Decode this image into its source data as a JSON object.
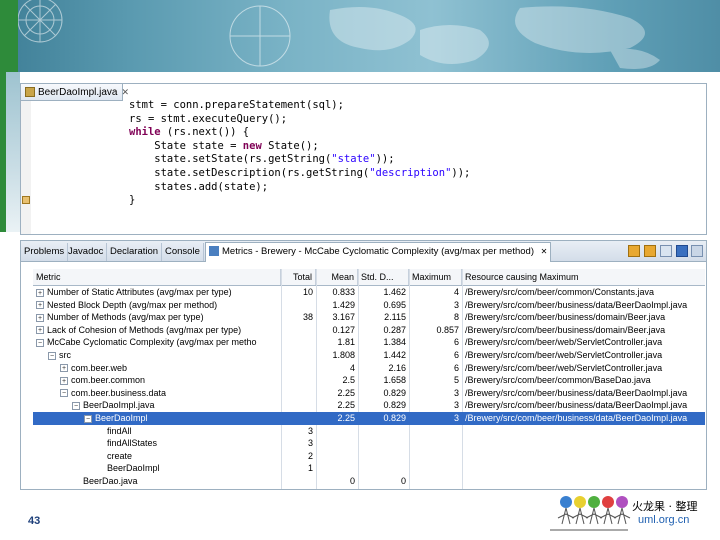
{
  "editor": {
    "tab_label": "BeerDaoImpl.java",
    "tab_close": "✕",
    "code_lines": [
      [
        {
          "t": "stmt = conn.prepareStatement(sql);"
        }
      ],
      [
        {
          "t": "rs = stmt.executeQuery();"
        }
      ],
      [
        {
          "t": "while",
          "k": "kw"
        },
        {
          "t": " (rs.next()) {"
        }
      ],
      [
        {
          "t": "    State state = "
        },
        {
          "t": "new",
          "k": "kw"
        },
        {
          "t": " State();"
        }
      ],
      [
        {
          "t": "    state.setState(rs.getString("
        },
        {
          "t": "\"state\"",
          "k": "str"
        },
        {
          "t": "));"
        }
      ],
      [
        {
          "t": "    state.setDescription(rs.getString("
        },
        {
          "t": "\"description\"",
          "k": "str"
        },
        {
          "t": "));"
        }
      ],
      [
        {
          "t": "    states.add(state);"
        }
      ],
      [
        {
          "t": "}"
        }
      ]
    ]
  },
  "views": {
    "tabs": [
      "Problems",
      "Javadoc",
      "Declaration",
      "Console"
    ],
    "active_tab": "Metrics - Brewery - McCabe Cyclomatic Complexity (avg/max per method)",
    "active_tab_close": "✕"
  },
  "table": {
    "columns": [
      "Metric",
      "Total",
      "Mean",
      "Std. D...",
      "Maximum",
      "Resource causing Maximum"
    ],
    "rows": [
      {
        "indent": 0,
        "exp": "+",
        "metric": "Number of Static Attributes (avg/max per type)",
        "total": "10",
        "mean": "0.833",
        "std": "1.462",
        "max": "4",
        "res": "/Brewery/src/com/beer/common/Constants.java"
      },
      {
        "indent": 0,
        "exp": "+",
        "metric": "Nested Block Depth (avg/max per method)",
        "total": "",
        "mean": "1.429",
        "std": "0.695",
        "max": "3",
        "res": "/Brewery/src/com/beer/business/data/BeerDaoImpl.java"
      },
      {
        "indent": 0,
        "exp": "+",
        "metric": "Number of Methods (avg/max per type)",
        "total": "38",
        "mean": "3.167",
        "std": "2.115",
        "max": "8",
        "res": "/Brewery/src/com/beer/business/domain/Beer.java"
      },
      {
        "indent": 0,
        "exp": "+",
        "metric": "Lack of Cohesion of Methods (avg/max per type)",
        "total": "",
        "mean": "0.127",
        "std": "0.287",
        "max": "0.857",
        "res": "/Brewery/src/com/beer/business/domain/Beer.java"
      },
      {
        "indent": 0,
        "exp": "−",
        "metric": "McCabe Cyclomatic Complexity (avg/max per metho",
        "total": "",
        "mean": "1.81",
        "std": "1.384",
        "max": "6",
        "res": "/Brewery/src/com/beer/web/ServletController.java"
      },
      {
        "indent": 1,
        "exp": "−",
        "metric": "src",
        "total": "",
        "mean": "1.808",
        "std": "1.442",
        "max": "6",
        "res": "/Brewery/src/com/beer/web/ServletController.java"
      },
      {
        "indent": 2,
        "exp": "+",
        "metric": "com.beer.web",
        "total": "",
        "mean": "4",
        "std": "2.16",
        "max": "6",
        "res": "/Brewery/src/com/beer/web/ServletController.java"
      },
      {
        "indent": 2,
        "exp": "+",
        "metric": "com.beer.common",
        "total": "",
        "mean": "2.5",
        "std": "1.658",
        "max": "5",
        "res": "/Brewery/src/com/beer/common/BaseDao.java"
      },
      {
        "indent": 2,
        "exp": "−",
        "metric": "com.beer.business.data",
        "total": "",
        "mean": "2.25",
        "std": "0.829",
        "max": "3",
        "res": "/Brewery/src/com/beer/business/data/BeerDaoImpl.java"
      },
      {
        "indent": 3,
        "exp": "−",
        "metric": "BeerDaoImpl.java",
        "total": "",
        "mean": "2.25",
        "std": "0.829",
        "max": "3",
        "res": "/Brewery/src/com/beer/business/data/BeerDaoImpl.java"
      },
      {
        "indent": 4,
        "exp": "−",
        "metric": "BeerDaoImpl",
        "total": "",
        "mean": "2.25",
        "std": "0.829",
        "max": "3",
        "res": "/Brewery/src/com/beer/business/data/BeerDaoImpl.java",
        "selected": true
      },
      {
        "indent": 5,
        "exp": "",
        "metric": "findAll",
        "total": "3",
        "mean": "",
        "std": "",
        "max": "",
        "res": ""
      },
      {
        "indent": 5,
        "exp": "",
        "metric": "findAllStates",
        "total": "3",
        "mean": "",
        "std": "",
        "max": "",
        "res": ""
      },
      {
        "indent": 5,
        "exp": "",
        "metric": "create",
        "total": "2",
        "mean": "",
        "std": "",
        "max": "",
        "res": ""
      },
      {
        "indent": 5,
        "exp": "",
        "metric": "BeerDaoImpl",
        "total": "1",
        "mean": "",
        "std": "",
        "max": "",
        "res": ""
      },
      {
        "indent": 3,
        "exp": "",
        "metric": "BeerDao.java",
        "total": "",
        "mean": "0",
        "std": "0",
        "max": "",
        "res": ""
      }
    ]
  },
  "page_number": "43",
  "logo": {
    "text_cn": "火龙果 · 整理",
    "url": "uml.org.cn"
  },
  "colors": {
    "selection": "#316ac5",
    "keyword": "#7f0055",
    "string": "#2a00ff",
    "page_number": "#1d3f7a",
    "logo_url": "#1e5fb0"
  }
}
